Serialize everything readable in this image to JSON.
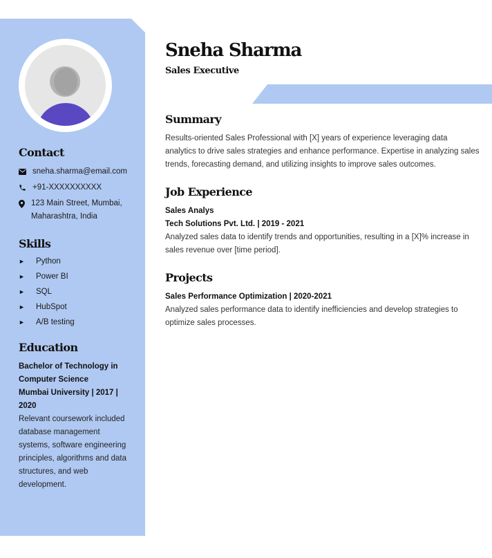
{
  "header": {
    "name": "Sneha Sharma",
    "role": "Sales Executive"
  },
  "sidebar": {
    "contact": {
      "heading": "Contact",
      "email": "sneha.sharma@email.com",
      "phone": "+91-XXXXXXXXXX",
      "address": "123 Main Street, Mumbai,\nMaharashtra, India"
    },
    "skills": {
      "heading": "Skills",
      "bullet": "►",
      "items": [
        "Python",
        "Power BI",
        "SQL",
        "HubSpot",
        "A/B testing"
      ]
    },
    "education": {
      "heading": "Education",
      "degree": "Bachelor of Technology in Computer Science",
      "institution": "Mumbai University | 2017 | 2020",
      "description": "Relevant coursework included database management systems, software engineering principles, algorithms and data structures, and web development."
    }
  },
  "main": {
    "summary": {
      "heading": "Summary",
      "text": "Results-oriented Sales Professional with [X] years of experience leveraging data analytics to drive sales strategies and enhance performance. Expertise in analyzing sales trends, forecasting demand, and utilizing insights to improve sales outcomes."
    },
    "experience": {
      "heading": "Job Experience",
      "title": "Sales Analys",
      "company": "Tech Solutions Pvt. Ltd. | 2019 - 2021",
      "description": "Analyzed sales data to identify trends and opportunities, resulting in a [X]% increase in sales revenue over [time period]."
    },
    "projects": {
      "heading": "Projects",
      "title": "Sales Performance Optimization | 2020-2021",
      "description": "Analyzed sales performance data to identify inefficiencies and develop strategies to optimize sales processes."
    }
  },
  "colors": {
    "accent": "#b0c9f2",
    "avatar_body": "#5a48c3"
  }
}
